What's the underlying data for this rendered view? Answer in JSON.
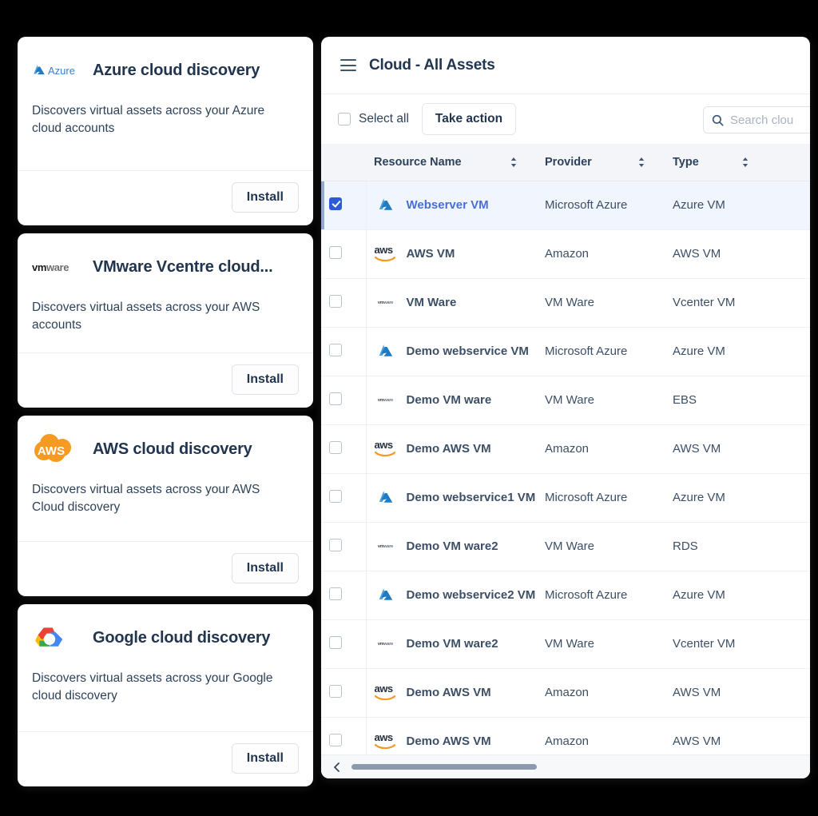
{
  "left_panel": {
    "cards": [
      {
        "logo": "azure-logo",
        "logo_text": "Azure",
        "title": "Azure cloud discovery",
        "description": "Discovers virtual assets across your Azure cloud accounts",
        "action_label": "Install"
      },
      {
        "logo": "vmware-logo",
        "logo_text": "vmware",
        "title": "VMware Vcentre cloud...",
        "description": "Discovers virtual assets across your AWS accounts",
        "action_label": "Install"
      },
      {
        "logo": "aws-cloud-logo",
        "logo_text": "AWS",
        "title": "AWS  cloud discovery",
        "description": "Discovers virtual assets across your AWS Cloud discovery",
        "action_label": "Install"
      },
      {
        "logo": "google-cloud-logo",
        "logo_text": "",
        "title": "Google cloud discovery",
        "description": "Discovers virtual assets across your Google cloud discovery",
        "action_label": "Install"
      }
    ]
  },
  "right_panel": {
    "header": {
      "menu_icon": "hamburger-icon",
      "title": "Cloud - All Assets"
    },
    "toolbar": {
      "select_all_label": "Select all",
      "select_all_checked": false,
      "take_action_label": "Take action",
      "search_placeholder": "Search clou",
      "search_value": "",
      "search_icon": "search-icon",
      "cursor_icon": "pointer-hand-cursor"
    },
    "table": {
      "columns": [
        {
          "key": "name",
          "label": "Resource Name",
          "sortable": true
        },
        {
          "key": "provider",
          "label": "Provider",
          "sortable": true
        },
        {
          "key": "type",
          "label": "Type",
          "sortable": true
        }
      ],
      "rows": [
        {
          "checked": true,
          "selected": true,
          "logo": "azure-icon",
          "name": "Webserver VM",
          "provider": "Microsoft Azure",
          "type": "Azure VM"
        },
        {
          "checked": false,
          "selected": false,
          "logo": "aws-icon",
          "name": "AWS VM",
          "provider": "Amazon",
          "type": "AWS VM"
        },
        {
          "checked": false,
          "selected": false,
          "logo": "vmware-icon",
          "name": "VM Ware",
          "provider": "VM Ware",
          "type": "Vcenter VM"
        },
        {
          "checked": false,
          "selected": false,
          "logo": "azure-icon",
          "name": "Demo webservice VM",
          "provider": "Microsoft Azure",
          "type": "Azure VM"
        },
        {
          "checked": false,
          "selected": false,
          "logo": "vmware-icon",
          "name": "Demo VM ware",
          "provider": "VM Ware",
          "type": "EBS"
        },
        {
          "checked": false,
          "selected": false,
          "logo": "aws-icon",
          "name": "Demo AWS VM",
          "provider": "Amazon",
          "type": "AWS VM"
        },
        {
          "checked": false,
          "selected": false,
          "logo": "azure-icon",
          "name": "Demo webservice1 VM",
          "provider": "Microsoft Azure",
          "type": "Azure VM"
        },
        {
          "checked": false,
          "selected": false,
          "logo": "vmware-icon",
          "name": "Demo VM ware2",
          "provider": "VM Ware",
          "type": "RDS"
        },
        {
          "checked": false,
          "selected": false,
          "logo": "azure-icon",
          "name": "Demo webservice2 VM",
          "provider": "Microsoft Azure",
          "type": "Azure VM"
        },
        {
          "checked": false,
          "selected": false,
          "logo": "vmware-icon",
          "name": "Demo VM ware2",
          "provider": "VM Ware",
          "type": "Vcenter VM"
        },
        {
          "checked": false,
          "selected": false,
          "logo": "aws-icon",
          "name": "Demo AWS VM",
          "provider": "Amazon",
          "type": "AWS VM"
        },
        {
          "checked": false,
          "selected": false,
          "logo": "aws-icon",
          "name": "Demo AWS VM",
          "provider": "Amazon",
          "type": "AWS VM"
        }
      ]
    },
    "scrollbar": {
      "left_arrow_icon": "chevron-left-icon"
    }
  },
  "colors": {
    "background": "#000000",
    "card_surface": "#ffffff",
    "text_primary": "#21354f",
    "text_secondary": "#3c4f66",
    "accent_blue": "#2d5bd7",
    "selected_row": "#f1f5fd",
    "azure_blue": "#2e92df",
    "aws_orange": "#f59a23",
    "table_header_bg": "#f3f5f9"
  }
}
